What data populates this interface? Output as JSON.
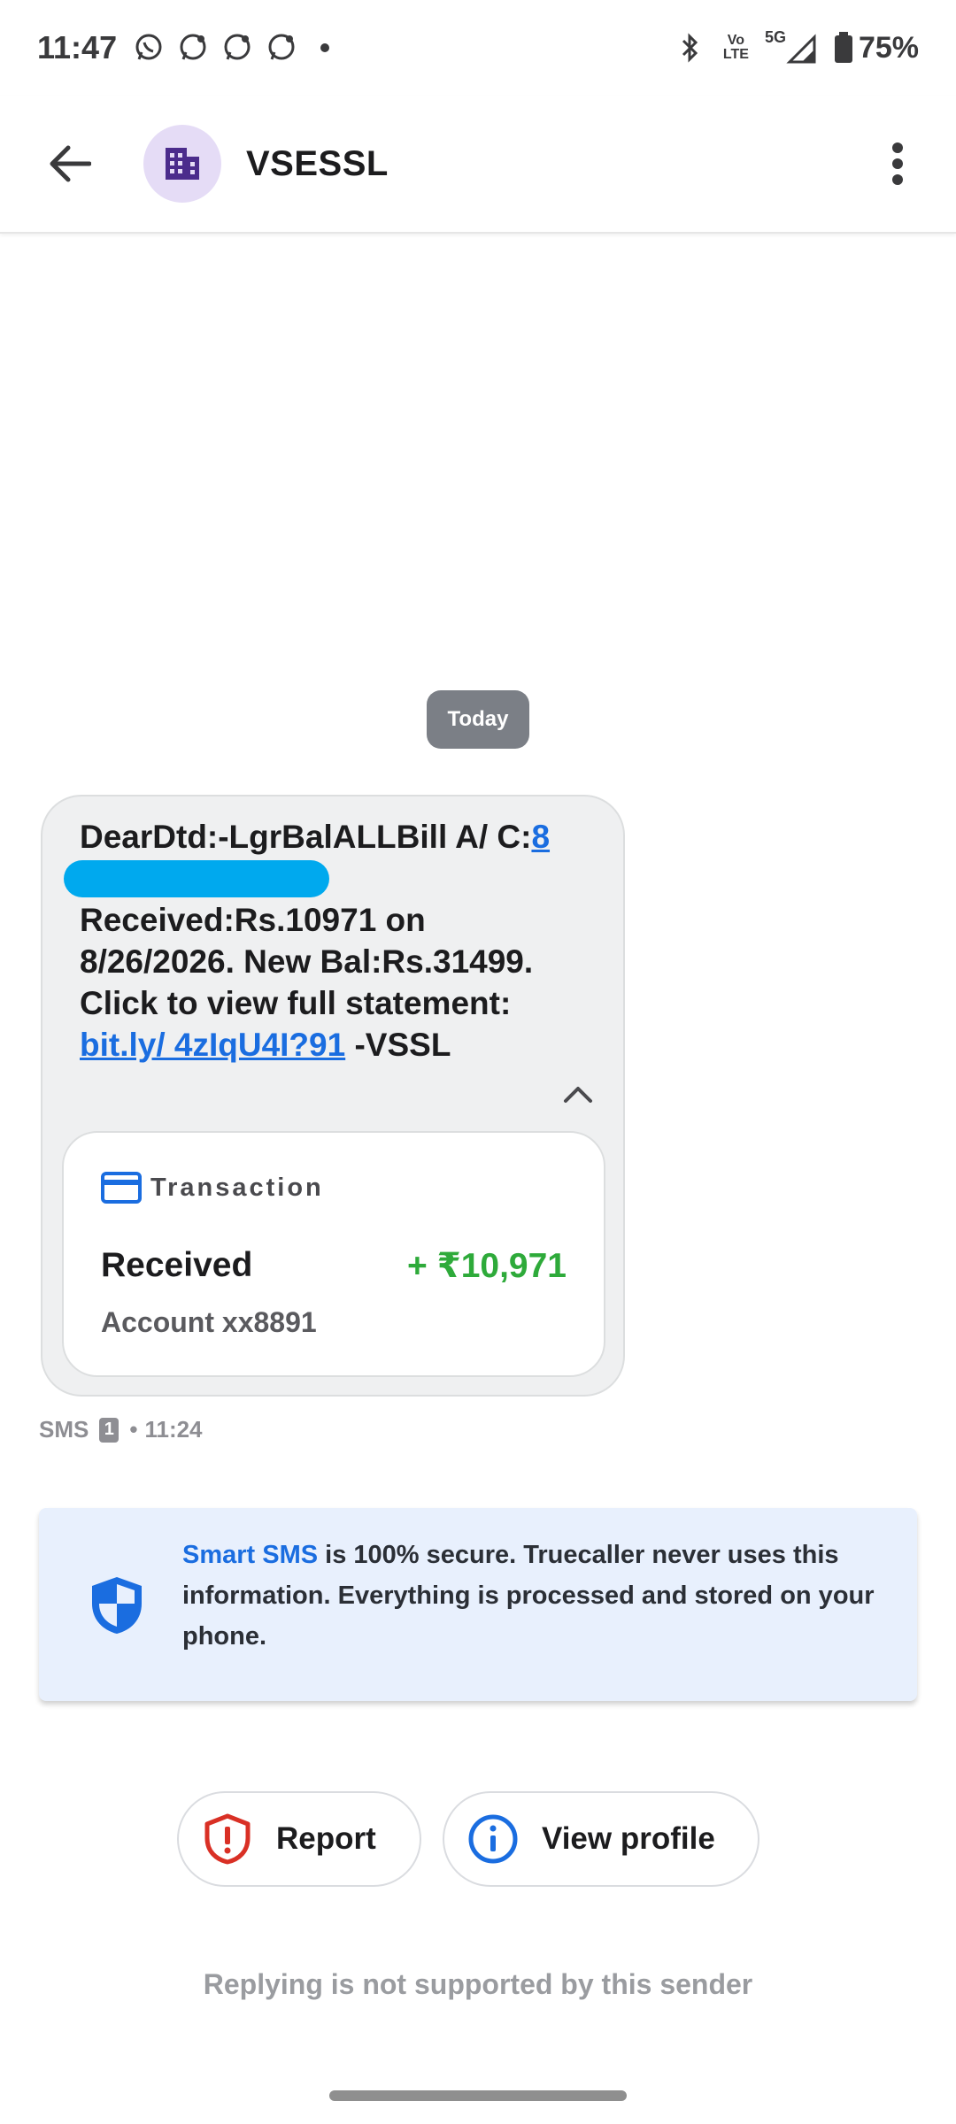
{
  "status_bar": {
    "time": "11:47",
    "network_top": "Vo",
    "network_bottom": "LTE",
    "signal_label": "5G",
    "battery": "75%",
    "icons": [
      "whatsapp-icon",
      "whatsapp-business-icon",
      "whatsapp-business-icon",
      "whatsapp-business-icon",
      "notification-dot",
      "bluetooth-icon",
      "volte-icon",
      "signal-5g-icon",
      "battery-icon"
    ]
  },
  "header": {
    "sender_name": "VSESSL",
    "avatar_icon": "building-icon",
    "back_icon": "arrow-left-icon",
    "menu_icon": "more-vert-icon"
  },
  "conversation": {
    "date_label": "Today",
    "message": {
      "text_part1": "DearDtd:-LgrBalALLBill A/ C:",
      "account_link_visible": "8",
      "text_part2": " Received:Rs.10971 on 8/26/2026. New Bal:Rs.31499. Click to view full statement: ",
      "link_text": "bit.ly/ 4zIqU4I?91",
      "text_part3": " -VSSL"
    },
    "transaction": {
      "title": "Transaction",
      "type": "Received",
      "amount": "+ ₹10,971",
      "account": "Account xx8891",
      "amount_color": "#2eaa3a"
    },
    "meta": {
      "channel": "SMS",
      "sim": "1",
      "separator": "•",
      "time": "11:24"
    }
  },
  "info_card": {
    "highlight": "Smart SMS",
    "text": " is 100% secure. Truecaller never uses this information. Everything is processed and stored on your phone."
  },
  "actions": {
    "report_label": "Report",
    "view_profile_label": "View profile"
  },
  "footer": {
    "reply_note": "Replying is not supported by this sender"
  },
  "colors": {
    "accent_blue": "#1a6de0",
    "redaction": "#00a9ee",
    "report_red": "#d93025",
    "avatar_bg": "#e5dcf6",
    "avatar_fg": "#4b2c8c"
  }
}
